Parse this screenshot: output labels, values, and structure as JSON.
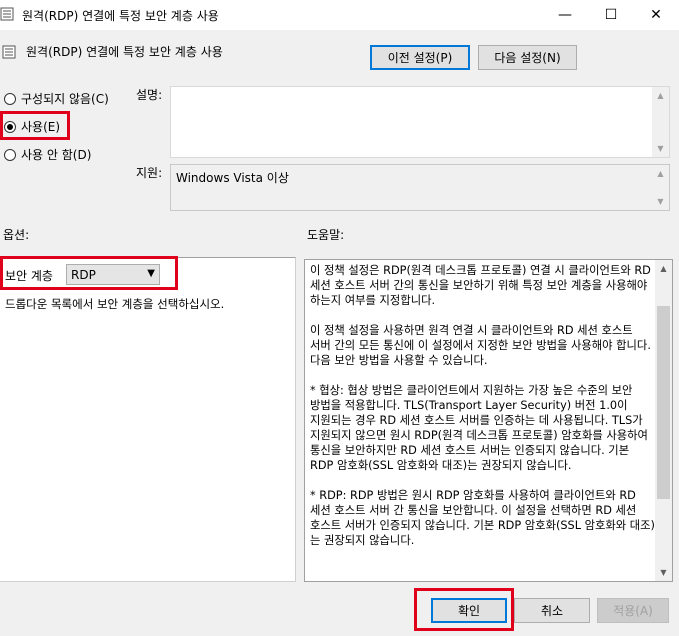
{
  "window": {
    "title": "원격(RDP) 연결에 특정 보안 계층 사용",
    "minimize": "—",
    "maximize": "☐",
    "close": "✕"
  },
  "header": {
    "title": "원격(RDP) 연결에 특정 보안 계층 사용",
    "prev_setting": "이전 설정(P)",
    "next_setting": "다음 설정(N)"
  },
  "state": {
    "not_configured": "구성되지 않음(C)",
    "enabled": "사용(E)",
    "disabled": "사용 안 함(D)",
    "selected": "enabled"
  },
  "comment": {
    "label": "설명:",
    "value": ""
  },
  "supported": {
    "label": "지원:",
    "value": "Windows Vista 이상"
  },
  "options": {
    "label": "옵션:",
    "security_layer_label": "보안 계층",
    "security_layer_value": "RDP",
    "hint": "드롭다운 목록에서 보안 계층을 선택하십시오."
  },
  "help": {
    "label": "도움말:",
    "text": "이 정책 설정은 RDP(원격 데스크톱 프로토콜) 연결 시 클라이언트와 RD 세션 호스트 서버 간의 통신을 보안하기 위해 특정 보안 계층을 사용해야 하는지 여부를 지정합니다.\n\n이 정책 설정을 사용하면 원격 연결 시 클라이언트와 RD 세션 호스트 서버 간의 모든 통신에 이 설정에서 지정한 보안 방법을 사용해야 합니다. 다음 보안 방법을 사용할 수 있습니다.\n\n* 협상: 협상 방법은 클라이언트에서 지원하는 가장 높은 수준의 보안 방법을 적용합니다. TLS(Transport Layer Security) 버전 1.0이 지원되는 경우 RD 세션 호스트 서버를 인증하는 데 사용됩니다. TLS가 지원되지 않으면 원시 RDP(원격 데스크톱 프로토콜) 암호화를 사용하여 통신을 보안하지만 RD 세션 호스트 서버는 인증되지 않습니다. 기본 RDP 암호화(SSL 암호화와 대조)는 권장되지 않습니다.\n\n* RDP: RDP 방법은 원시 RDP 암호화를 사용하여 클라이언트와 RD 세션 호스트 서버 간 통신을 보안합니다. 이 설정을 선택하면 RD 세션 호스트 서버가 인증되지 않습니다. 기본 RDP 암호화(SSL 암호화와 대조)는 권장되지 않습니다."
  },
  "footer": {
    "ok": "확인",
    "cancel": "취소",
    "apply": "적용(A)"
  }
}
